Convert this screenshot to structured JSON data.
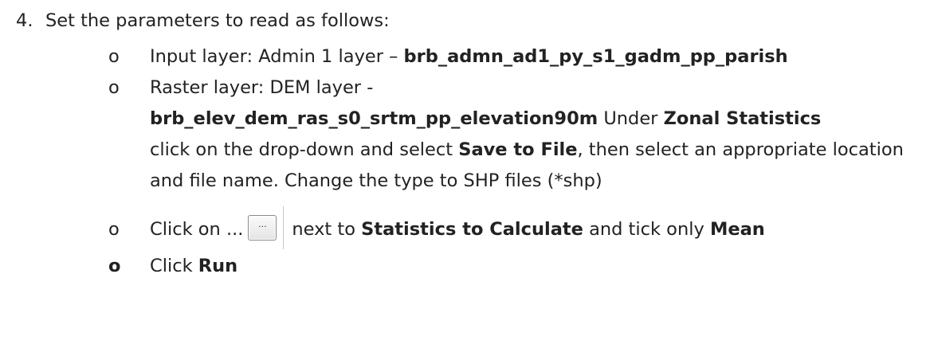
{
  "step": {
    "number": "4.",
    "text": "Set the parameters to read as follows:"
  },
  "bullets": {
    "marker": "o",
    "input_layer": {
      "prefix": "Input layer: Admin 1 layer – ",
      "value": "brb_admn_ad1_py_s1_gadm_pp_parish"
    },
    "raster_layer": {
      "prefix": "Raster layer: DEM layer -",
      "value": "brb_elev_dem_ras_s0_srtm_pp_elevation90m",
      "under": " Under ",
      "zonal_statistics": "Zonal Statistics",
      "click_dropdown": "click on the drop-down and select ",
      "save_to_file": "Save to File",
      "rest": ", then select an appropriate location and file name. Change the type to SHP files (*shp)"
    },
    "statistics": {
      "click_on": "Click on ...",
      "button_label": "...",
      "next_to": "next to ",
      "statistics_to_calculate": "Statistics to Calculate",
      "tick_only": " and tick only ",
      "mean": "Mean"
    },
    "run": {
      "click": "Click ",
      "run": "Run"
    }
  }
}
